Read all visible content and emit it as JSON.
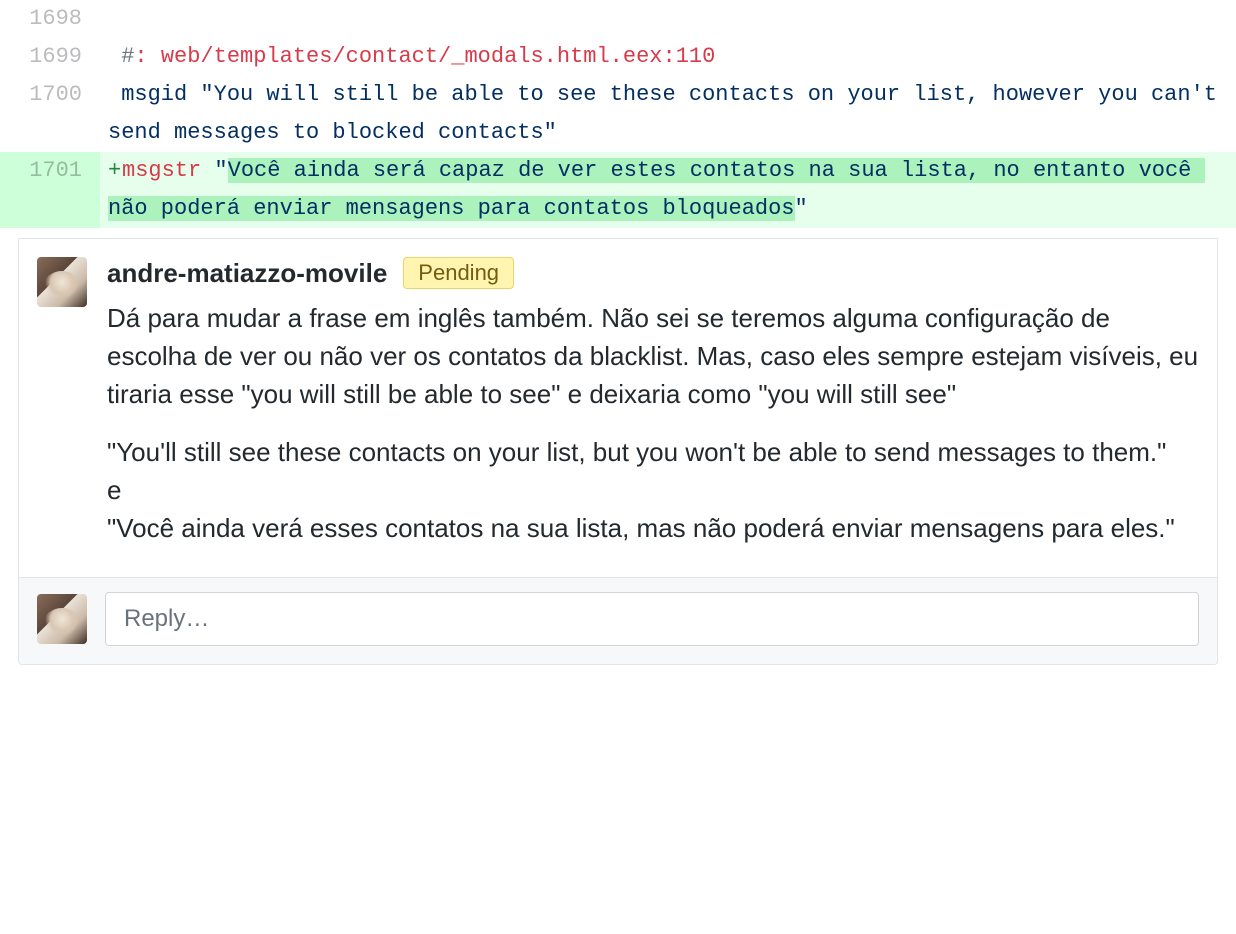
{
  "diff": {
    "lines": {
      "l1698": {
        "lineno": "1698",
        "type": "context"
      },
      "l1699": {
        "lineno": "1699",
        "type": "context",
        "hash": "#",
        "colon": ": ",
        "path": "web/templates/contact/_modals.html.eex:110"
      },
      "l1700": {
        "lineno": "1700",
        "type": "context",
        "kw": "msgid",
        "sp": " ",
        "str": "\"You will still be able to see these contacts on your list, however you can't send messages to blocked contacts\""
      },
      "l1701": {
        "lineno": "1701",
        "type": "addition",
        "marker": "+",
        "kw": "msgstr",
        "sp": " ",
        "q1": "\"",
        "hi": "Você ainda será capaz de ver estes contatos na sua lista, no entanto você não poderá enviar mensagens para contatos bloqueados",
        "q2": "\""
      }
    }
  },
  "comment": {
    "author": "andre-matiazzo-movile",
    "badge": "Pending",
    "paragraphs": {
      "p1": "Dá para mudar a frase em inglês também. Não sei se teremos alguma configuração de escolha de ver ou não ver os contatos da blacklist. Mas, caso eles sempre estejam visíveis, eu tiraria esse \"you will still be able to see\" e deixaria como \"you will still see\"",
      "p2_l1": "\"You'll still see these contacts on your list, but you won't be able to send messages to them.\"",
      "p2_l2": "e",
      "p2_l3": "\"Você ainda verá esses contatos na sua lista, mas não poderá enviar mensagens para eles.\""
    }
  },
  "reply": {
    "placeholder": "Reply…"
  }
}
